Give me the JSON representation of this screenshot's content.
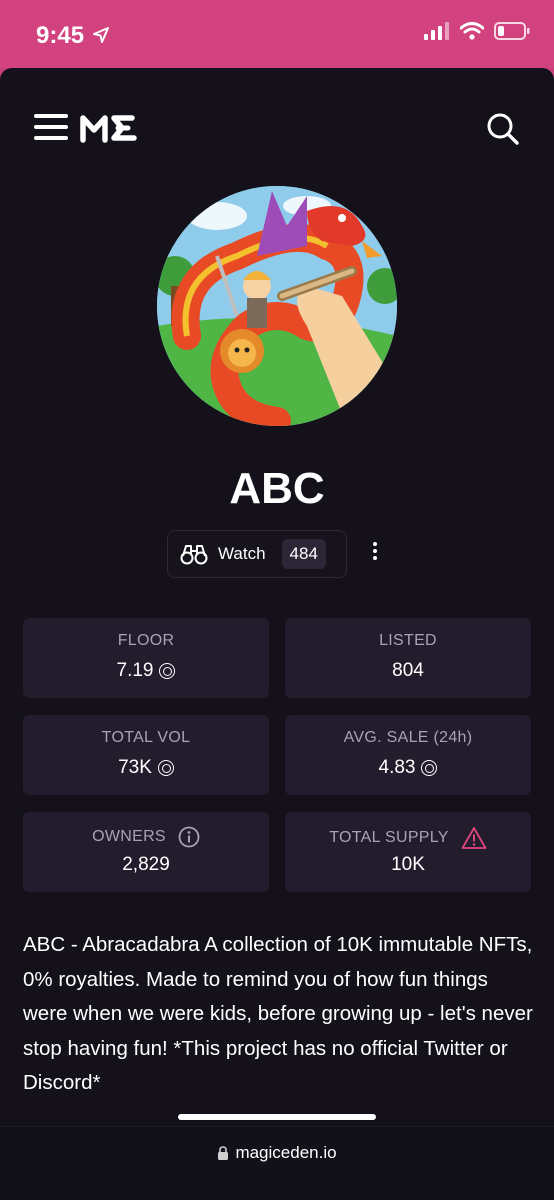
{
  "status_bar": {
    "time": "9:45",
    "icons": [
      "location-arrow-icon",
      "signal-icon",
      "wifi-icon",
      "battery-icon"
    ],
    "battery_level": 0.2,
    "accent_color": "#d2427e"
  },
  "nav": {
    "menu_icon": "hamburger-menu-icon",
    "logo": "ME",
    "search_icon": "search-icon"
  },
  "collection": {
    "name": "ABC",
    "watch_label": "Watch",
    "watch_count": "484"
  },
  "stats": {
    "floor": {
      "label": "FLOOR",
      "value": "7.19"
    },
    "listed": {
      "label": "LISTED",
      "value": "804"
    },
    "total_vol": {
      "label": "TOTAL VOL",
      "value": "73K"
    },
    "avg_sale": {
      "label": "AVG. SALE (24h)",
      "value": "4.83"
    },
    "owners": {
      "label": "OWNERS",
      "value": "2,829"
    },
    "total_supply": {
      "label": "TOTAL SUPPLY",
      "value": "10K"
    }
  },
  "description": "ABC - Abracadabra A collection of 10K immutable NFTs, 0% royalties. Made to remind you of how fun things were when we were kids, before growing up - let's never stop having fun! *This project has no official Twitter or Discord*",
  "url_bar": {
    "url": "magiceden.io"
  },
  "colors": {
    "background": "#14111a",
    "card": "#221c2c",
    "warning": "#e0457b"
  }
}
